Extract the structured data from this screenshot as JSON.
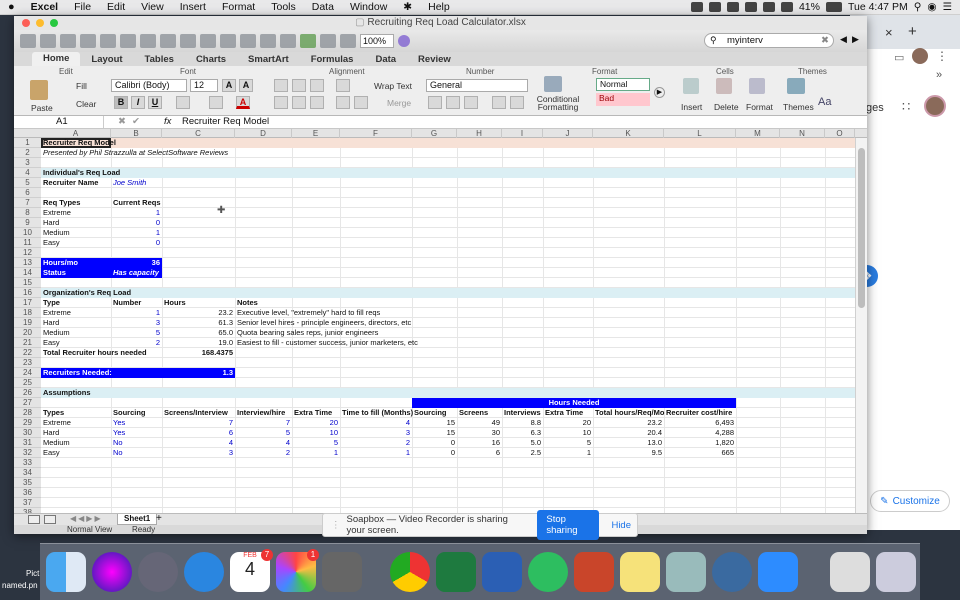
{
  "menubar": {
    "apple": "",
    "app": "Excel",
    "items": [
      "File",
      "Edit",
      "View",
      "Insert",
      "Format",
      "Tools",
      "Data",
      "Window",
      "Help"
    ],
    "battery": "41%",
    "clock": "Tue 4:47 PM"
  },
  "window": {
    "title": "Recruiting Req Load Calculator.xlsx",
    "zoom": "100%",
    "search_value": "myinterv"
  },
  "ribbon_tabs": [
    "Home",
    "Layout",
    "Tables",
    "Charts",
    "SmartArt",
    "Formulas",
    "Data",
    "Review"
  ],
  "ribbon": {
    "groups": [
      "Edit",
      "Font",
      "Alignment",
      "Number",
      "Format",
      "Cells",
      "Themes"
    ],
    "paste": "Paste",
    "fill": "Fill",
    "clear": "Clear",
    "font_name": "Calibri (Body)",
    "font_size": "12",
    "wrap_text": "Wrap Text",
    "merge": "Merge",
    "number_format": "General",
    "cond_fmt": "Conditional Formatting",
    "style_normal": "Normal",
    "style_bad": "Bad",
    "insert": "Insert",
    "delete": "Delete",
    "format": "Format",
    "themes": "Themes",
    "bold": "B",
    "italic": "I",
    "underline": "U"
  },
  "formula_bar": {
    "cell_ref": "A1",
    "fx": "fx",
    "content": "Recruiter Req Model"
  },
  "columns": [
    "A",
    "B",
    "C",
    "D",
    "E",
    "F",
    "G",
    "H",
    "I",
    "J",
    "K",
    "L",
    "M",
    "N",
    "O"
  ],
  "rows": [
    "1",
    "2",
    "3",
    "4",
    "5",
    "6",
    "7",
    "8",
    "9",
    "10",
    "11",
    "12",
    "13",
    "14",
    "15",
    "16",
    "17",
    "18",
    "19",
    "20",
    "21",
    "22",
    "23",
    "24",
    "25",
    "26",
    "27",
    "28",
    "29",
    "30",
    "31",
    "32",
    "33",
    "34",
    "35",
    "36",
    "37",
    "38",
    "39"
  ],
  "cells": {
    "a1": "Recruiter Req Model",
    "a2": "Presented by Phil Strazzulla at SelectSoftware Reviews",
    "a4": "Individual's Req Load",
    "a5": "Recruiter Name",
    "b5": "Joe Smith",
    "a7": "Req Types",
    "b7": "Current Reqs",
    "a8": "Extreme",
    "b8": "1",
    "a9": "Hard",
    "b9": "0",
    "a10": "Medium",
    "b10": "1",
    "a11": "Easy",
    "b11": "0",
    "a13": "Hours/mo",
    "b13": "36",
    "a14": "Status",
    "b14": "Has capacity",
    "a16": "Organization's Req Load",
    "a17": "Type",
    "b17": "Number",
    "c17": "Hours",
    "d17": "Notes",
    "a18": "Extreme",
    "b18": "1",
    "c18": "23.2",
    "d18": "Executive level, \"extremely\" hard to fill reqs",
    "a19": "Hard",
    "b19": "3",
    "c19": "61.3",
    "d19": "Senior level hires - principle engineers, directors, etc",
    "a20": "Medium",
    "b20": "5",
    "c20": "65.0",
    "d20": "Quota bearing sales reps, junior engineers",
    "a21": "Easy",
    "b21": "2",
    "c21": "19.0",
    "d21": "Easiest to fill - customer success, junior marketers, etc",
    "a22": "Total Recruiter hours needed",
    "c22": "168.4375",
    "a24": "Recruiters Needed:",
    "c24": "1.3",
    "a26": "Assumptions",
    "g27": "Hours Needed",
    "a28": "Types",
    "b28": "Sourcing",
    "c28": "Screens/Interview",
    "d28": "Interview/hire",
    "e28": "Extra Time",
    "f28": "Time to fill (Months)",
    "g28": "Sourcing",
    "h28": "Screens",
    "i28": "Interviews",
    "j28": "Extra Time",
    "k28": "Total hours/Req/Mo",
    "l28": "Recruiter cost/hire",
    "a29": "Extreme",
    "b29": "Yes",
    "c29": "7",
    "d29": "7",
    "e29": "20",
    "f29": "4",
    "g29": "15",
    "h29": "49",
    "i29": "8.8",
    "j29": "20",
    "k29": "23.2",
    "l29": "6,493",
    "a30": "Hard",
    "b30": "Yes",
    "c30": "6",
    "d30": "5",
    "e30": "10",
    "f30": "3",
    "g30": "15",
    "h30": "30",
    "i30": "6.3",
    "j30": "10",
    "k30": "20.4",
    "l30": "4,288",
    "a31": "Medium",
    "b31": "No",
    "c31": "4",
    "d31": "4",
    "e31": "5",
    "f31": "2",
    "g31": "0",
    "h31": "16",
    "i31": "5.0",
    "j31": "5",
    "k31": "13.0",
    "l31": "1,820",
    "a32": "Easy",
    "b32": "No",
    "c32": "3",
    "d32": "2",
    "e32": "1",
    "f32": "1",
    "g32": "0",
    "h32": "6",
    "i32": "2.5",
    "j32": "1",
    "k32": "9.5",
    "l32": "665"
  },
  "sheet": {
    "tab": "Sheet1",
    "add": "+",
    "view": "Normal View",
    "status": "Ready"
  },
  "notification": {
    "text": "Soapbox — Video Recorder is sharing your screen.",
    "stop": "Stop sharing",
    "hide": "Hide"
  },
  "background": {
    "close": "×",
    "new_tab": "+",
    "partial": "ges",
    "customize": "Customize"
  },
  "dock": {
    "calendar_month": "FEB",
    "calendar_day": "4",
    "calendar_badge": "7",
    "photos_badge": "1"
  },
  "desktop": {
    "file1": "Pict",
    "file2": "named.pn"
  },
  "colors": {
    "blue_fill": "#0000ff",
    "header_fill": "#dbeff4",
    "accent": "#1a73e8"
  }
}
